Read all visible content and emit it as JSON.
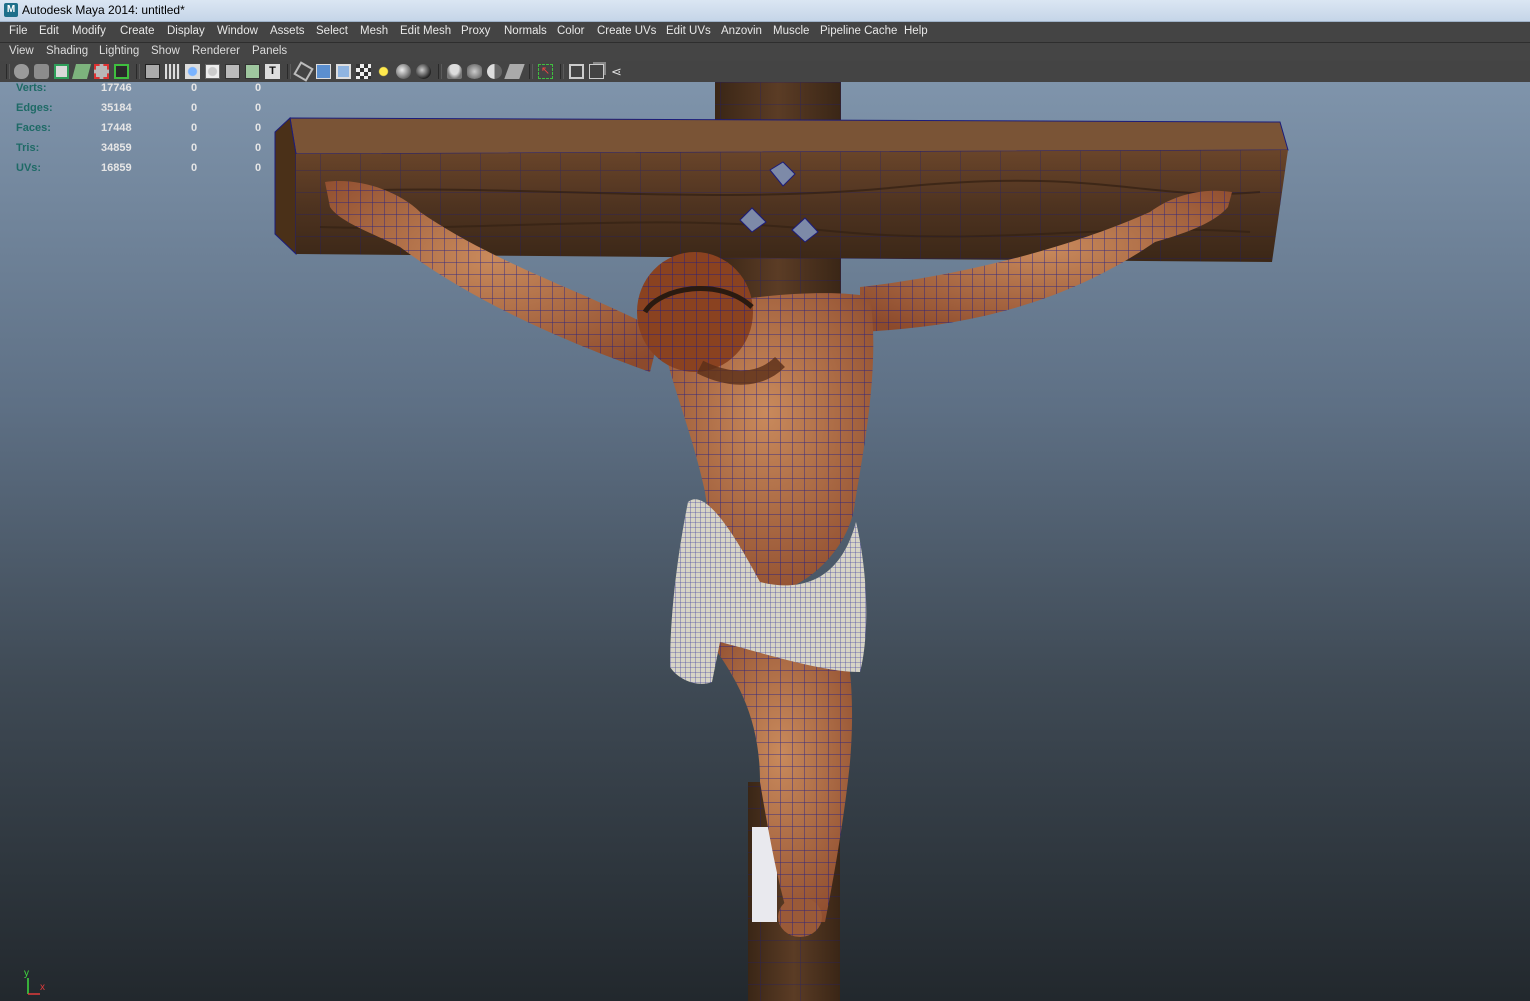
{
  "window": {
    "title": "Autodesk Maya 2014: untitled*"
  },
  "menubar": {
    "items": [
      "File",
      "Edit",
      "Modify",
      "Create",
      "Display",
      "Window",
      "Assets",
      "Select",
      "Mesh",
      "Edit Mesh",
      "Proxy",
      "Normals",
      "Color",
      "Create UVs",
      "Edit UVs",
      "Anzovin",
      "Muscle",
      "Pipeline Cache",
      "Help"
    ]
  },
  "panel_menu": {
    "items": [
      "View",
      "Shading",
      "Lighting",
      "Show",
      "Renderer",
      "Panels"
    ]
  },
  "toolbar": {
    "icons": [
      "camera-select-icon",
      "camera-attributes-icon",
      "bookmarks-icon",
      "image-plane-icon",
      "grid-icon",
      "film-gate-icon",
      "resolution-gate-icon",
      "wireframe-icon",
      "smooth-shade-icon",
      "textured-icon",
      "default-lighting-icon",
      "xray-icon",
      "shadows-icon",
      "ambient-occlusion-icon",
      "isolate-select-icon"
    ]
  },
  "hud": {
    "rows": [
      {
        "label": "Verts:",
        "v1": "17746",
        "v2": "0",
        "v3": "0"
      },
      {
        "label": "Edges:",
        "v1": "35184",
        "v2": "0",
        "v3": "0"
      },
      {
        "label": "Faces:",
        "v1": "17448",
        "v2": "0",
        "v3": "0"
      },
      {
        "label": "Tris:",
        "v1": "34859",
        "v2": "0",
        "v3": "0"
      },
      {
        "label": "UVs:",
        "v1": "16859",
        "v2": "0",
        "v3": "0"
      }
    ]
  },
  "axis": {
    "y": "y",
    "x": "x"
  },
  "colors": {
    "wireframe": "#1a1a8a",
    "wood": "#5a3a22",
    "skin": "#b56a45",
    "cloth": "#d7d4c6",
    "hud_label": "#1e6a66"
  }
}
